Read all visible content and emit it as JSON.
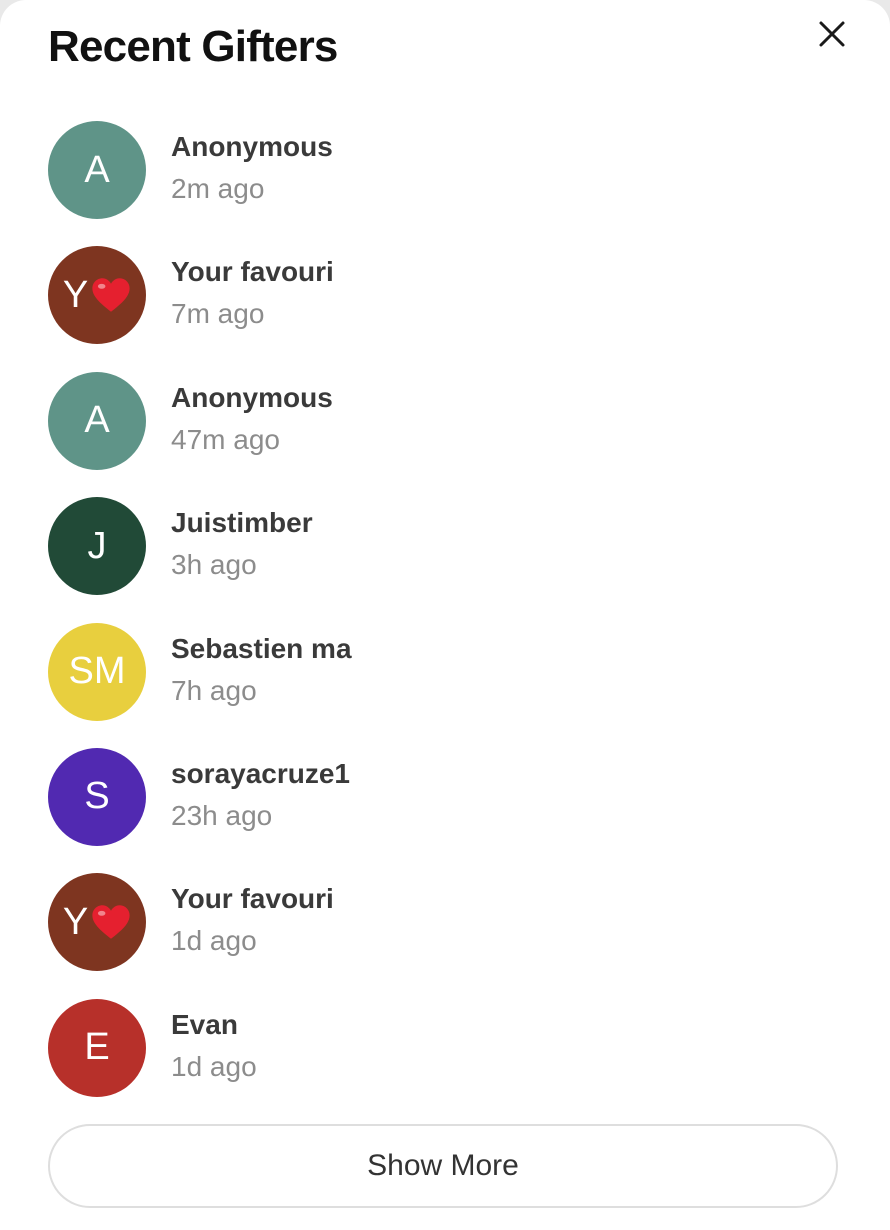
{
  "header": {
    "title": "Recent Gifters",
    "close_icon": "close-icon"
  },
  "gifters": [
    {
      "initials": "A",
      "heart": false,
      "name": "Anonymous",
      "time": "2m ago",
      "color": "#5f9488"
    },
    {
      "initials": "Y",
      "heart": true,
      "name": "Your favouri",
      "time": "7m ago",
      "color": "#7e3520"
    },
    {
      "initials": "A",
      "heart": false,
      "name": "Anonymous",
      "time": "47m ago",
      "color": "#5f9488"
    },
    {
      "initials": "J",
      "heart": false,
      "name": "Juistimber",
      "time": "3h ago",
      "color": "#214a37"
    },
    {
      "initials": "SM",
      "heart": false,
      "name": "Sebastien ma",
      "time": "7h ago",
      "color": "#e8cf3e"
    },
    {
      "initials": "S",
      "heart": false,
      "name": "sorayacruze1",
      "time": "23h ago",
      "color": "#5129b1"
    },
    {
      "initials": "Y",
      "heart": true,
      "name": "Your favouri",
      "time": "1d ago",
      "color": "#7e3520"
    },
    {
      "initials": "E",
      "heart": false,
      "name": "Evan",
      "time": "1d ago",
      "color": "#b7302a"
    }
  ],
  "footer": {
    "show_more_label": "Show More"
  },
  "colors": {
    "heart": "#e5202f",
    "title": "#111111",
    "name": "#3a3a3a",
    "time": "#8c8c8c"
  }
}
